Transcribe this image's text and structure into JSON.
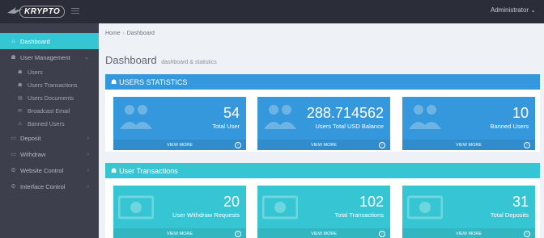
{
  "app": {
    "brand": "KRYPTO",
    "user_menu": "Administrator"
  },
  "sidebar": {
    "items": [
      {
        "label": "Dashboard",
        "icon": "home-icon"
      },
      {
        "label": "User Management",
        "icon": "users-icon"
      },
      {
        "label": "Deposit",
        "icon": "card-icon"
      },
      {
        "label": "Withdraw",
        "icon": "card-icon"
      },
      {
        "label": "Website Control",
        "icon": "gears-icon"
      },
      {
        "label": "Interface Control",
        "icon": "gears-icon"
      }
    ],
    "sub_items": [
      {
        "label": "Users",
        "icon": "users-icon"
      },
      {
        "label": "Users Transactions",
        "icon": "users-icon"
      },
      {
        "label": "Users Documents",
        "icon": "file-icon"
      },
      {
        "label": "Broadcast Email",
        "icon": "mail-icon"
      },
      {
        "label": "Banned Users",
        "icon": "ban-user-icon"
      }
    ]
  },
  "breadcrumb": {
    "home": "Home",
    "current": "Dashboard"
  },
  "page": {
    "title": "Dashboard",
    "subtitle": "dashboard & statistics"
  },
  "users_panel": {
    "title": "USERS STATISTICS",
    "stats": [
      {
        "value": "54",
        "label": "Total User",
        "more": "VIEW MORE"
      },
      {
        "value": "288.714562",
        "label": "Users Total USD Balance",
        "more": "VIEW MORE"
      },
      {
        "value": "10",
        "label": "Banned Users",
        "more": "VIEW MORE"
      }
    ]
  },
  "transactions_panel": {
    "title": "User Transactions",
    "stats": [
      {
        "value": "20",
        "label": "User Withdraw Requests",
        "more": "VIEW MORE"
      },
      {
        "value": "102",
        "label": "Total Transactions",
        "more": "VIEW MORE"
      },
      {
        "value": "31",
        "label": "Total Deposits",
        "more": "VIEW MORE"
      }
    ]
  },
  "colors": {
    "blue": "#3598dc",
    "teal": "#36c6d3",
    "sidebar": "#3d3f4d",
    "topbar": "#2b2e38"
  }
}
